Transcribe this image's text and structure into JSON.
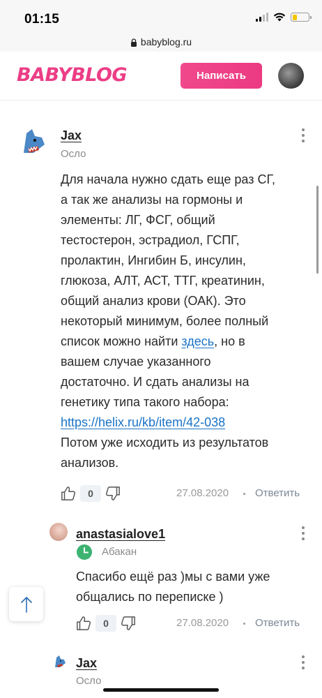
{
  "status_bar": {
    "time": "01:15"
  },
  "browser": {
    "url": "babyblog.ru"
  },
  "header": {
    "logo": "BABYBLOG",
    "write_button": "Написать"
  },
  "comments": [
    {
      "author": "Jax",
      "city": "Осло",
      "text_lines": [
        "Для начала нужно сдать еще раз СГ,",
        "а так же анализы на гормоны и",
        "элементы: ЛГ, ФСГ, общий",
        "тестостерон, эстрадиол, ГСПГ,",
        "пролактин, Ингибин Б, инсулин,",
        "глюкоза, АЛТ, АСТ, ТТГ, креатинин,",
        "общий анализ крови (ОАК). Это",
        "некоторый минимум, более полный"
      ],
      "line9_before": "список можно найти ",
      "link_here": "здесь",
      "line9_after": ", но в",
      "text_lines_2": [
        "вашем случае указанного",
        "достаточно. И сдать анализы на",
        "генетику типа такого набора:"
      ],
      "link_url": "https://helix.ru/kb/item/42-038",
      "text_lines_3": [
        "Потом уже исходить из результатов",
        "анализов."
      ],
      "likes": "0",
      "date": "27.08.2020",
      "reply": "Ответить"
    },
    {
      "author": "anastasialove1",
      "city": "Абакан",
      "text_lines": [
        "Спасибо ещё раз )мы с вами уже",
        "общались по переписке )"
      ],
      "likes": "0",
      "date": "27.08.2020",
      "reply": "Ответить"
    },
    {
      "author": "Jax",
      "city": "Осло"
    }
  ],
  "colors": {
    "brand": "#ec3e86",
    "link": "#1a73c6",
    "online": "#3cb371"
  }
}
